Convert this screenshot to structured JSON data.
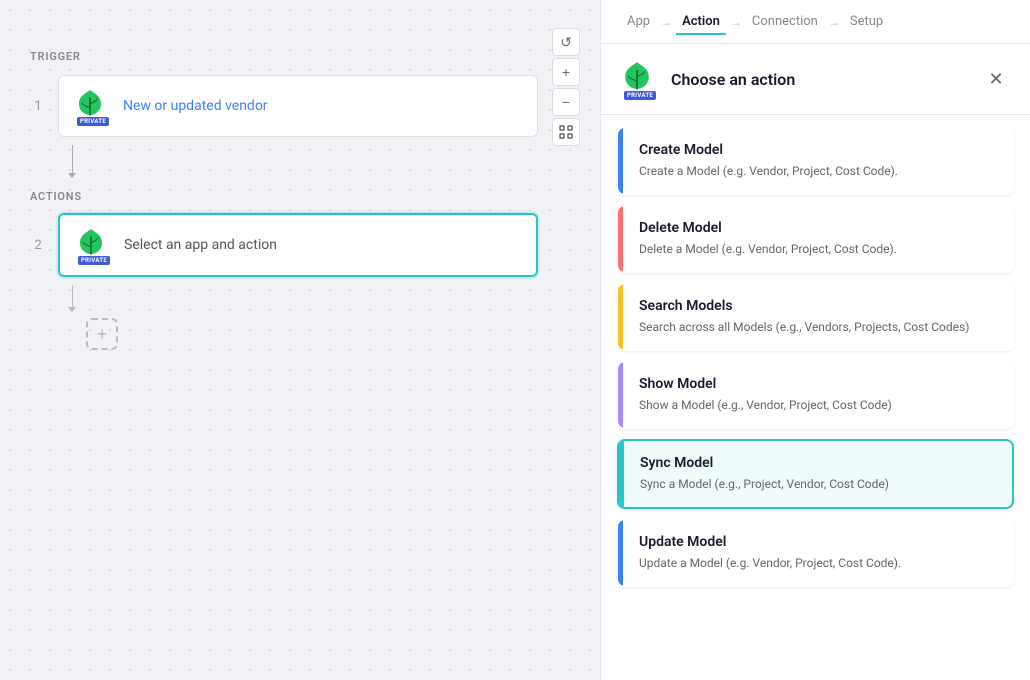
{
  "left": {
    "trigger_label": "TRIGGER",
    "actions_label": "ACTIONS",
    "step1_number": "1",
    "step2_number": "2",
    "trigger_text_prefix": "New or updated ",
    "trigger_text_link": "vendor",
    "action_placeholder": "Select an app and action",
    "private_badge": "PRIVATE",
    "toolbar": {
      "reset": "↺",
      "zoom_in": "+",
      "zoom_out": "−",
      "fit": "⊕"
    }
  },
  "right": {
    "nav": {
      "app": "App",
      "action": "Action",
      "connection": "Connection",
      "setup": "Setup"
    },
    "header_title": "Choose an action",
    "actions": [
      {
        "id": "create-model",
        "title": "Create Model",
        "description": "Create a Model (e.g. Vendor, Project, Cost Code).",
        "bar_color": "#3b82f6",
        "selected": false
      },
      {
        "id": "delete-model",
        "title": "Delete Model",
        "description": "Delete a Model (e.g. Vendor, Project, Cost Code).",
        "bar_color": "#f87171",
        "selected": false
      },
      {
        "id": "search-models",
        "title": "Search Models",
        "description": "Search across all Models (e.g., Vendors, Projects, Cost Codes)",
        "bar_color": "#fbbf24",
        "selected": false
      },
      {
        "id": "show-model",
        "title": "Show Model",
        "description": "Show a Model (e.g., Vendor, Project, Cost Code)",
        "bar_color": "#a78bfa",
        "selected": false
      },
      {
        "id": "sync-model",
        "title": "Sync Model",
        "description": "Sync a Model (e.g., Project, Vendor, Cost Code)",
        "bar_color": "#26c6c6",
        "selected": true
      },
      {
        "id": "update-model",
        "title": "Update Model",
        "description": "Update a Model (e.g. Vendor, Project, Cost Code).",
        "bar_color": "#3b82f6",
        "selected": false
      }
    ]
  }
}
